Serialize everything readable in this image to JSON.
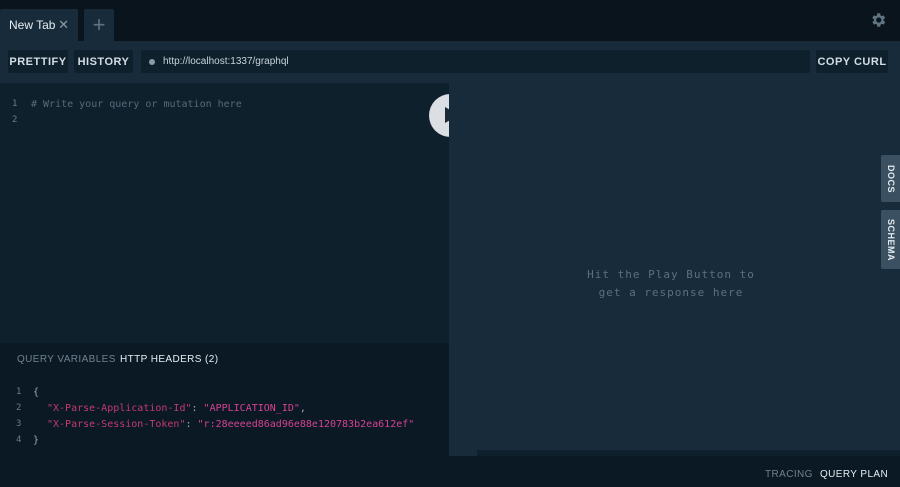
{
  "tabs": [
    {
      "label": "New Tab",
      "close": "✕"
    }
  ],
  "add_tab_label": "+",
  "toolbar": {
    "prettify_label": "PRETTIFY",
    "history_label": "HISTORY",
    "url": "http://localhost:1337/graphql",
    "copy_curl_label": "COPY CURL"
  },
  "editor": {
    "line_numbers": [
      "1",
      "2"
    ],
    "lines": [
      "# Write your query or mutation here",
      ""
    ]
  },
  "variables": {
    "tab_query_variables": "QUERY VARIABLES",
    "tab_http_headers": "HTTP HEADERS (2)",
    "line_numbers": [
      "1",
      "2",
      "3",
      "4"
    ],
    "open_brace": "{",
    "close_brace": "}",
    "headers": [
      {
        "key": "\"X-Parse-Application-Id\"",
        "sep": ": ",
        "value": "\"APPLICATION_ID\"",
        "trail": ","
      },
      {
        "key": "\"X-Parse-Session-Token\"",
        "sep": ": ",
        "value": "\"r:28eeeed86ad96e88e120783b2ea612ef\"",
        "trail": ""
      }
    ]
  },
  "result": {
    "message_line1": "Hit the Play Button to",
    "message_line2": "get a response here",
    "docs_label": "DOCS",
    "schema_label": "SCHEMA"
  },
  "footer": {
    "tracing_label": "TRACING",
    "query_plan_label": "QUERY PLAN"
  },
  "icons": {
    "settings": "gear-icon",
    "play": "play-icon"
  },
  "colors": {
    "background": "#0f202d",
    "panel": "#172b3a",
    "header_key": "#c13b71",
    "header_value": "#d64292"
  }
}
